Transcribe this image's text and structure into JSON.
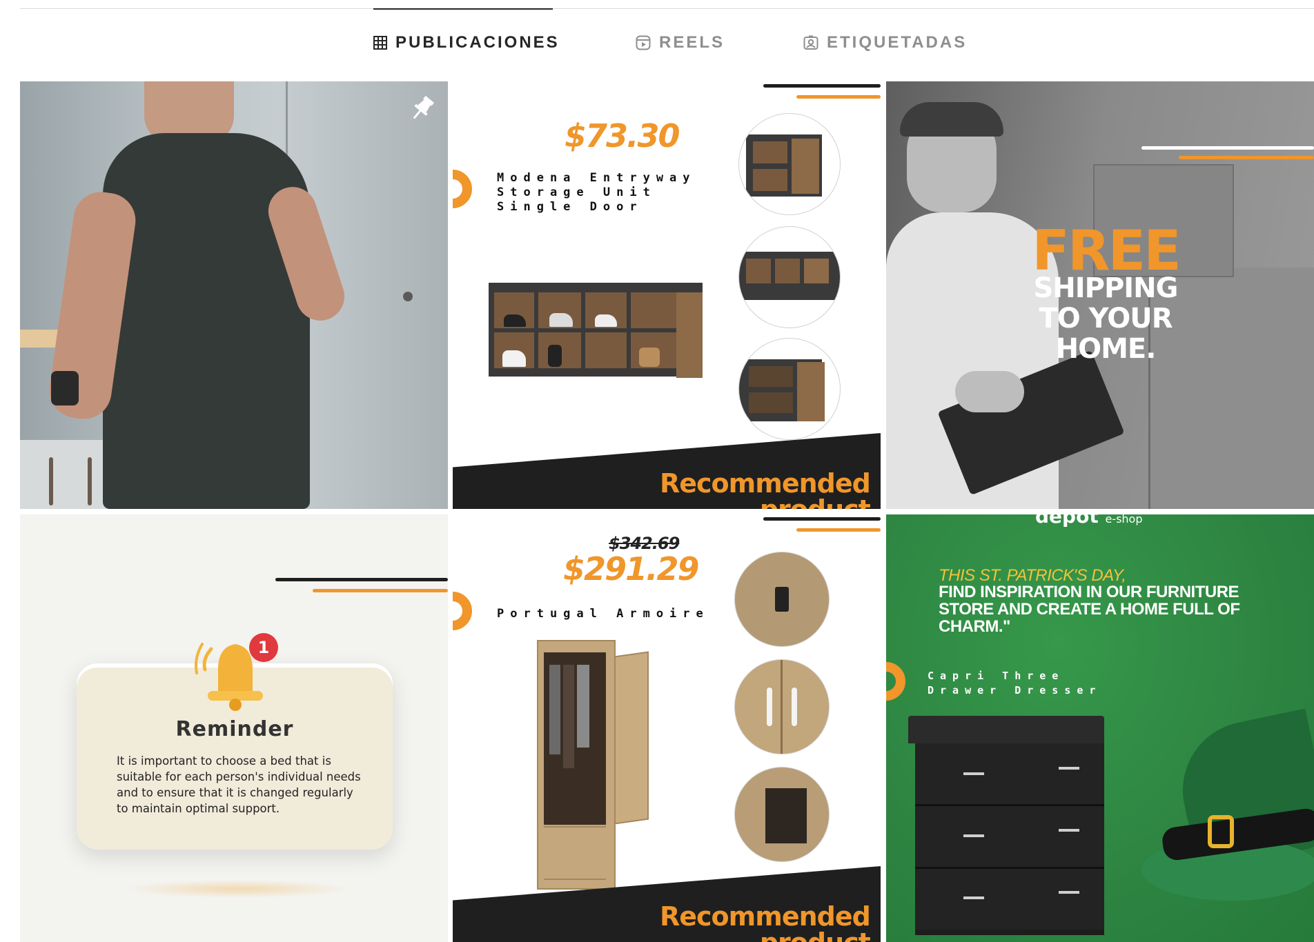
{
  "tabs": [
    {
      "label": "PUBLICACIONES",
      "icon": "grid-icon",
      "active": true
    },
    {
      "label": "REELS",
      "icon": "reels-icon",
      "active": false
    },
    {
      "label": "ETIQUETADAS",
      "icon": "tagged-icon",
      "active": false
    }
  ],
  "posts": {
    "p1": {
      "pinned": true,
      "icon": "pin-icon"
    },
    "p2": {
      "price": "$73.30",
      "name": "Modena Entryway\nStorage Unit\nSingle Door",
      "badge": "Recommended\nproduct"
    },
    "p3": {
      "line1": "FREE",
      "line2": "SHIPPING",
      "line3": "TO YOUR",
      "line4": "HOME."
    },
    "p4": {
      "title": "Reminder",
      "notification_count": "1",
      "body": "It is important to choose a bed that is suitable for each person's individual needs and to ensure that it is changed regularly to maintain optimal support."
    },
    "p5": {
      "old_price": "$342.69",
      "price": "$291.29",
      "name": "Portugal Armoire",
      "badge": "Recommended\nproduct"
    },
    "p6": {
      "brand": "depot",
      "brand_suffix": "e-shop",
      "headline_italic": "THIS ST. PATRICK'S DAY,",
      "headline": "FIND INSPIRATION IN OUR FURNITURE STORE AND CREATE A HOME FULL OF CHARM.\"",
      "name": "Capri Three\nDrawer Dresser"
    }
  },
  "colors": {
    "accent_orange": "#f0962b",
    "dark": "#1e1e1e",
    "green": "#2f8a43",
    "reminder_bg": "#f3f3f0"
  }
}
